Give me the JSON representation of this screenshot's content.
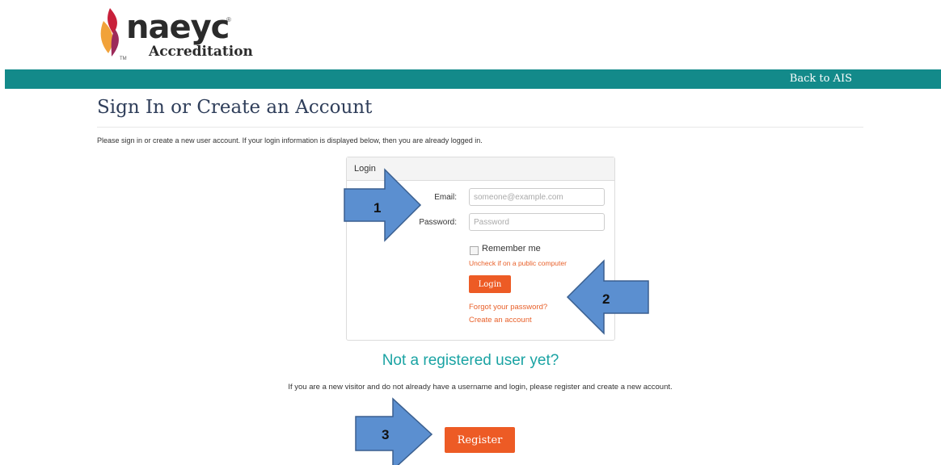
{
  "brand": {
    "name": "naeyc",
    "subtitle": "Accreditation",
    "tm": "TM",
    "reg": "®",
    "colors": {
      "flame_red": "#c8203a",
      "flame_orange": "#f1a23a",
      "flame_magenta": "#9c2a5a"
    }
  },
  "topbar": {
    "back_link": "Back to AIS",
    "color": "#138a8a"
  },
  "page": {
    "title": "Sign In or Create an Account",
    "intro": "Please sign in or create a new user account. If your login information is displayed below, then you are already logged in."
  },
  "login_panel": {
    "heading": "Login",
    "email_label": "Email:",
    "email_placeholder": "someone@example.com",
    "password_label": "Password:",
    "password_placeholder": "Password",
    "remember_label": "Remember me",
    "remember_hint": "Uncheck if on a public computer",
    "login_button": "Login",
    "forgot_link": "Forgot your password?",
    "create_link": "Create an account"
  },
  "register": {
    "heading": "Not a registered user yet?",
    "text": "If you are a new visitor and do not already have a username and login, please register and create a new account.",
    "button": "Register"
  },
  "annotations": {
    "arrow_1": "1",
    "arrow_2": "2",
    "arrow_3": "3",
    "fill_color": "#5b8fd0",
    "stroke_color": "#3a5f8f"
  }
}
